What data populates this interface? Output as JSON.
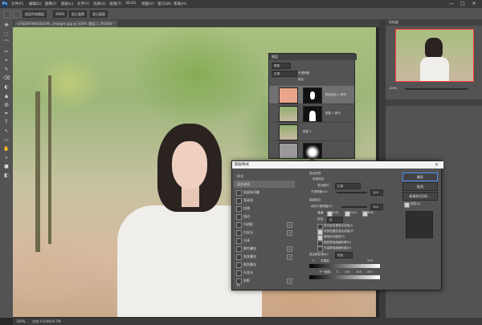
{
  "app": {
    "logo": "Ps"
  },
  "menu": [
    "文件(F)",
    "编辑(E)",
    "图像(I)",
    "图层(L)",
    "文字(Y)",
    "选择(S)",
    "滤镜(T)",
    "3D(D)",
    "视图(V)",
    "窗口(W)",
    "帮助(H)"
  ],
  "window_buttons": [
    "—",
    "□",
    "✕"
  ],
  "options": {
    "mode": "选区所有图层",
    "zoom": "100%",
    "checkbox1": "显示变换",
    "checkbox2": "显示画面"
  },
  "document_tab": "v7AE04F9A642b7e9...(margin).jpg @ 100% (图层 1, RGB/8) *",
  "layers": {
    "title": "图层",
    "kind": "类型",
    "blend": "正常",
    "opacity_label": "不透明度",
    "fill_label": "填充",
    "rows": [
      {
        "name": "颜色填充 1 拷贝"
      },
      {
        "name": "图层 1 拷贝"
      },
      {
        "name": "图层 1"
      },
      {
        "name": ""
      }
    ]
  },
  "navigator": {
    "title": "导航器",
    "zoom": "100%"
  },
  "dialog": {
    "title": "图层样式",
    "styles_header": "样式",
    "blend_options": "混合选项",
    "items": [
      "斜面和浮雕",
      "等高线",
      "纹理",
      "描边",
      "内阴影",
      "内发光",
      "光泽",
      "颜色叠加",
      "渐变叠加",
      "图案叠加",
      "外发光",
      "投影"
    ],
    "fx": "fx",
    "section1": "混合选项",
    "section1_sub": "常规混合",
    "blend_mode_label": "混合模式:",
    "blend_mode": "正常",
    "opacity_label": "不透明度(O):",
    "opacity": "100",
    "section2": "高级混合",
    "fill_opacity_label": "填充不透明度(F):",
    "fill_opacity": "100",
    "channels_label": "通道:",
    "channels": [
      "R(R)",
      "G(G)",
      "B(B)"
    ],
    "knockout_label": "挖空:",
    "knockout": "无",
    "options": [
      "将内部效果混合成组(I)",
      "将剪贴图层混合成组(P)",
      "透明形状图层(T)",
      "图层蒙版隐藏效果(S)",
      "矢量蒙版隐藏效果(H)"
    ],
    "blend_if_label": "混合颜色带(E):",
    "blend_if": "灰色",
    "this_layer": "本图层:",
    "this_layer_values": [
      "0",
      "255"
    ],
    "under_layer": "下一图层:",
    "under_layer_values": [
      "0",
      "191",
      "255",
      "255"
    ],
    "buttons": [
      "确定",
      "取消",
      "新建样式(W)..."
    ],
    "preview_label": "预览(V)"
  },
  "status": {
    "zoom": "100%",
    "doc": "文档:4.41M/34.7M"
  }
}
